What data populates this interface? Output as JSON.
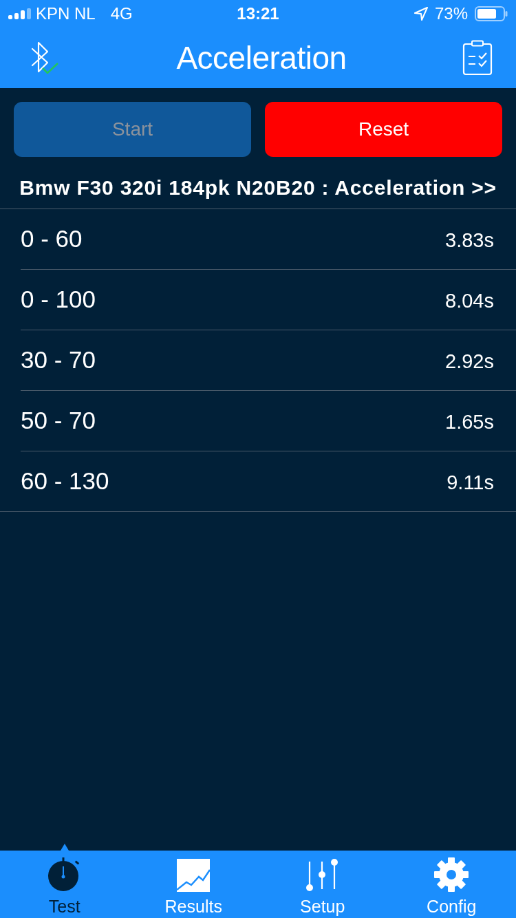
{
  "status_bar": {
    "carrier": "KPN NL",
    "network": "4G",
    "time": "13:21",
    "battery": "73%"
  },
  "nav_bar": {
    "title": "Acceleration",
    "bluetooth_connected": true
  },
  "buttons": [
    {
      "label": "Start",
      "disabled": true,
      "color": "#10589a"
    },
    {
      "label": "Reset",
      "disabled": false,
      "color": "#ff0000"
    }
  ],
  "heading": "Bmw F30 320i 184pk N20B20 : Acceleration >>",
  "results": [
    {
      "range": "0 - 60",
      "time": "3.83s"
    },
    {
      "range": "0 - 100",
      "time": "8.04s"
    },
    {
      "range": "30 - 70",
      "time": "2.92s"
    },
    {
      "range": "50 - 70",
      "time": "1.65s"
    },
    {
      "range": "60 - 130",
      "time": "9.11s"
    }
  ],
  "tabs": [
    {
      "label": "Test",
      "kind": "stopwatch",
      "selected": true
    },
    {
      "label": "Results",
      "kind": "chart",
      "selected": false
    },
    {
      "label": "Setup",
      "kind": "sliders",
      "selected": false
    },
    {
      "label": "Config",
      "kind": "gear",
      "selected": false
    }
  ]
}
